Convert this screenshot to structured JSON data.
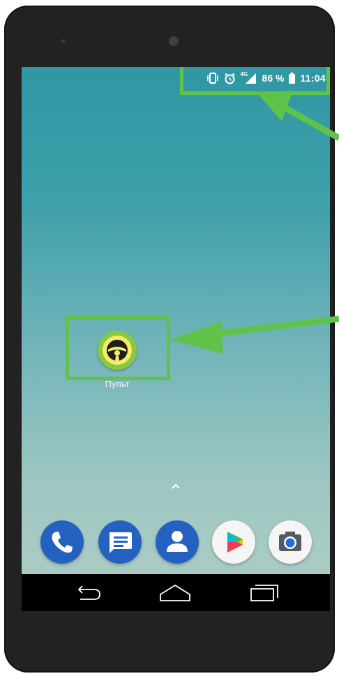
{
  "device": {
    "frame_color": "#222223",
    "accent_highlight": "#5ec24b"
  },
  "status_bar": {
    "icons": [
      "vibrate-icon",
      "alarm-icon",
      "signal-4g-icon",
      "battery-icon"
    ],
    "network_label": "4G",
    "battery_percent": "86 %",
    "time": "11:04"
  },
  "home_screen": {
    "apps": [
      {
        "label": "Пульт",
        "icon": "steering-wheel-icon"
      }
    ],
    "app_drawer_icon": "chevron-up-icon"
  },
  "dock": {
    "items": [
      {
        "name": "phone",
        "icon": "phone-icon"
      },
      {
        "name": "messages",
        "icon": "message-icon"
      },
      {
        "name": "contacts",
        "icon": "contacts-icon"
      },
      {
        "name": "play-store",
        "icon": "play-store-icon"
      },
      {
        "name": "camera",
        "icon": "camera-icon"
      }
    ]
  },
  "navigation_bar": {
    "buttons": [
      "back-icon",
      "home-icon",
      "recents-icon"
    ]
  }
}
